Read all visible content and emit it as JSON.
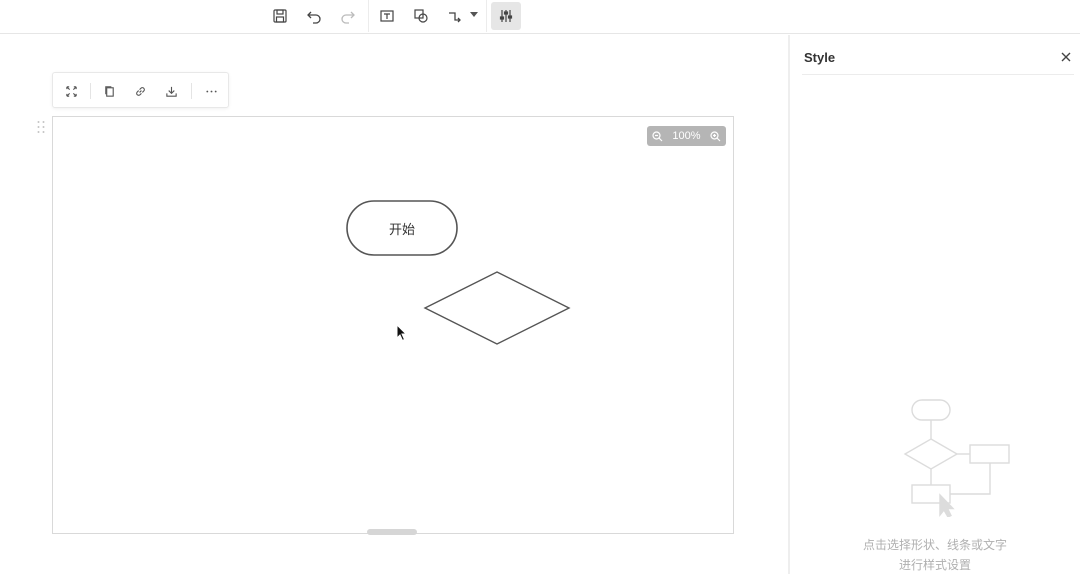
{
  "toolbar": {
    "items": [
      {
        "name": "save-icon"
      },
      {
        "name": "undo-icon"
      },
      {
        "name": "redo-icon"
      },
      {
        "name": "text-icon"
      },
      {
        "name": "shape-icon"
      },
      {
        "name": "connector-icon"
      },
      {
        "name": "style-settings-icon",
        "active": true
      }
    ]
  },
  "float_toolbar": {
    "items": [
      "fullscreen-icon",
      "copy-icon",
      "link-icon",
      "download-icon",
      "more-icon"
    ]
  },
  "canvas": {
    "zoom": "100%",
    "shapes": [
      {
        "type": "terminal",
        "label": "开始"
      },
      {
        "type": "decision",
        "label": ""
      }
    ]
  },
  "panel": {
    "title": "Style",
    "hint_line1": "点击选择形状、线条或文字",
    "hint_line2": "进行样式设置"
  },
  "colors": {
    "stroke": "#555555",
    "zoom_pill": "#b5b5b5",
    "active_bg": "#e6e6e6"
  }
}
